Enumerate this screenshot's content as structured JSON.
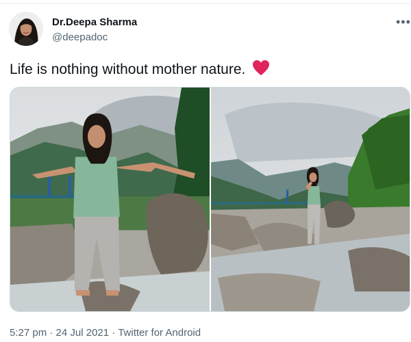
{
  "author": {
    "display_name": "Dr.Deepa Sharma",
    "handle": "@deepadoc",
    "avatar_icon": "profile-photo"
  },
  "menu_icon": "more-horizontal-icon",
  "tweet": {
    "text": "Life is nothing without mother nature.",
    "emoji_icon": "red-heart-icon",
    "emoji_color": "#e0245e"
  },
  "media": {
    "photo_count": 2
  },
  "meta": {
    "time": "5:27 pm",
    "separator": "·",
    "date": "24 Jul 2021",
    "source": "Twitter for Android"
  },
  "colors": {
    "text_primary": "#0f1419",
    "text_secondary": "#536471",
    "border": "#cfd9de"
  }
}
